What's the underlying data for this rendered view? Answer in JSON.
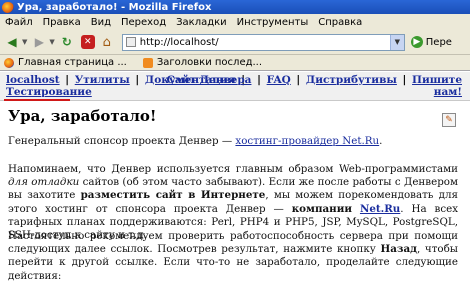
{
  "window": {
    "title": "Ура, заработало! - Mozilla Firefox"
  },
  "menu": [
    "Файл",
    "Правка",
    "Вид",
    "Переход",
    "Закладки",
    "Инструменты",
    "Справка"
  ],
  "toolbar": {
    "address": "http://localhost/",
    "go_label": "Пере"
  },
  "bookmarks": [
    "Главная страница ...",
    "Заголовки послед..."
  ],
  "nav": {
    "left": [
      "localhost",
      "Утилиты",
      "Документация",
      "Тестирование"
    ],
    "right": [
      "Сайт Денвера",
      "FAQ",
      "Дистрибутивы",
      "Пишите",
      "нам!"
    ]
  },
  "page": {
    "heading": "Ура, заработало!",
    "p1_text": "Генеральный спонсор проекта Денвер — ",
    "p1_link": "хостинг-провайдер Net.Ru",
    "p1_end": ".",
    "p2_a": "Напоминаем, что Денвер используется главным образом Web-программистами ",
    "p2_i": "для отладки",
    "p2_b": " сайтов (об этом часто забывают). Если же после работы с Денвером вы захотите ",
    "p2_bold": "разместить сайт в Интернете",
    "p2_c": ", мы можем порекомендовать для этого хостинг от спонсора проекта Денвер — ",
    "p2_bold2": "компании",
    "p2_link": "Net.Ru",
    "p2_d": ". На всех тарифных планах поддерживаются: Perl, PHP4 и PHP5, JSP, MySQL, PostgreSQL, SSH-доступ к сайту и т.д.",
    "p3_a": "Настоятельно рекомендуем проверить работоспособность сервера при помощи следующих далее ссылок. Посмотрев результат, нажмите кнопку ",
    "p3_bold": "Назад",
    "p3_b": ", чтобы перейти к другой ссылке. Если что-то не заработало, проделайте следующие действия:"
  }
}
